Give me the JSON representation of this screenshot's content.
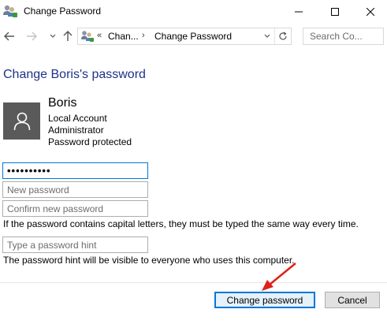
{
  "window": {
    "title": "Change Password",
    "controls": {
      "minimize": "minimize-icon",
      "maximize": "maximize-icon",
      "close": "close-icon"
    }
  },
  "navigation": {
    "back_icon": "back-arrow-icon",
    "forward_icon": "forward-arrow-icon",
    "recent_icon": "chevron-down-icon",
    "up_icon": "up-arrow-icon",
    "address": {
      "overflow": "«",
      "crumbs": [
        "Chan...",
        "Change Password"
      ],
      "separator": "›",
      "refresh_icon": "refresh-icon"
    },
    "search": {
      "placeholder": "Search Co..."
    }
  },
  "main": {
    "heading": "Change Boris's password",
    "user": {
      "avatar_icon": "user-icon",
      "name": "Boris",
      "account_type": "Local Account",
      "role": "Administrator",
      "status": "Password protected"
    },
    "form": {
      "current_password_value": "••••••••••",
      "new_password_placeholder": "New password",
      "confirm_password_placeholder": "Confirm new password",
      "caps_note": "If the password contains capital letters, they must be typed the same way every time.",
      "hint_placeholder": "Type a password hint",
      "hint_note": "The password hint will be visible to everyone who uses this computer."
    }
  },
  "footer": {
    "change_label": "Change password",
    "cancel_label": "Cancel"
  },
  "colors": {
    "heading": "#1e3287",
    "focus_border": "#0078d7",
    "annotation_arrow": "#e0201b"
  }
}
